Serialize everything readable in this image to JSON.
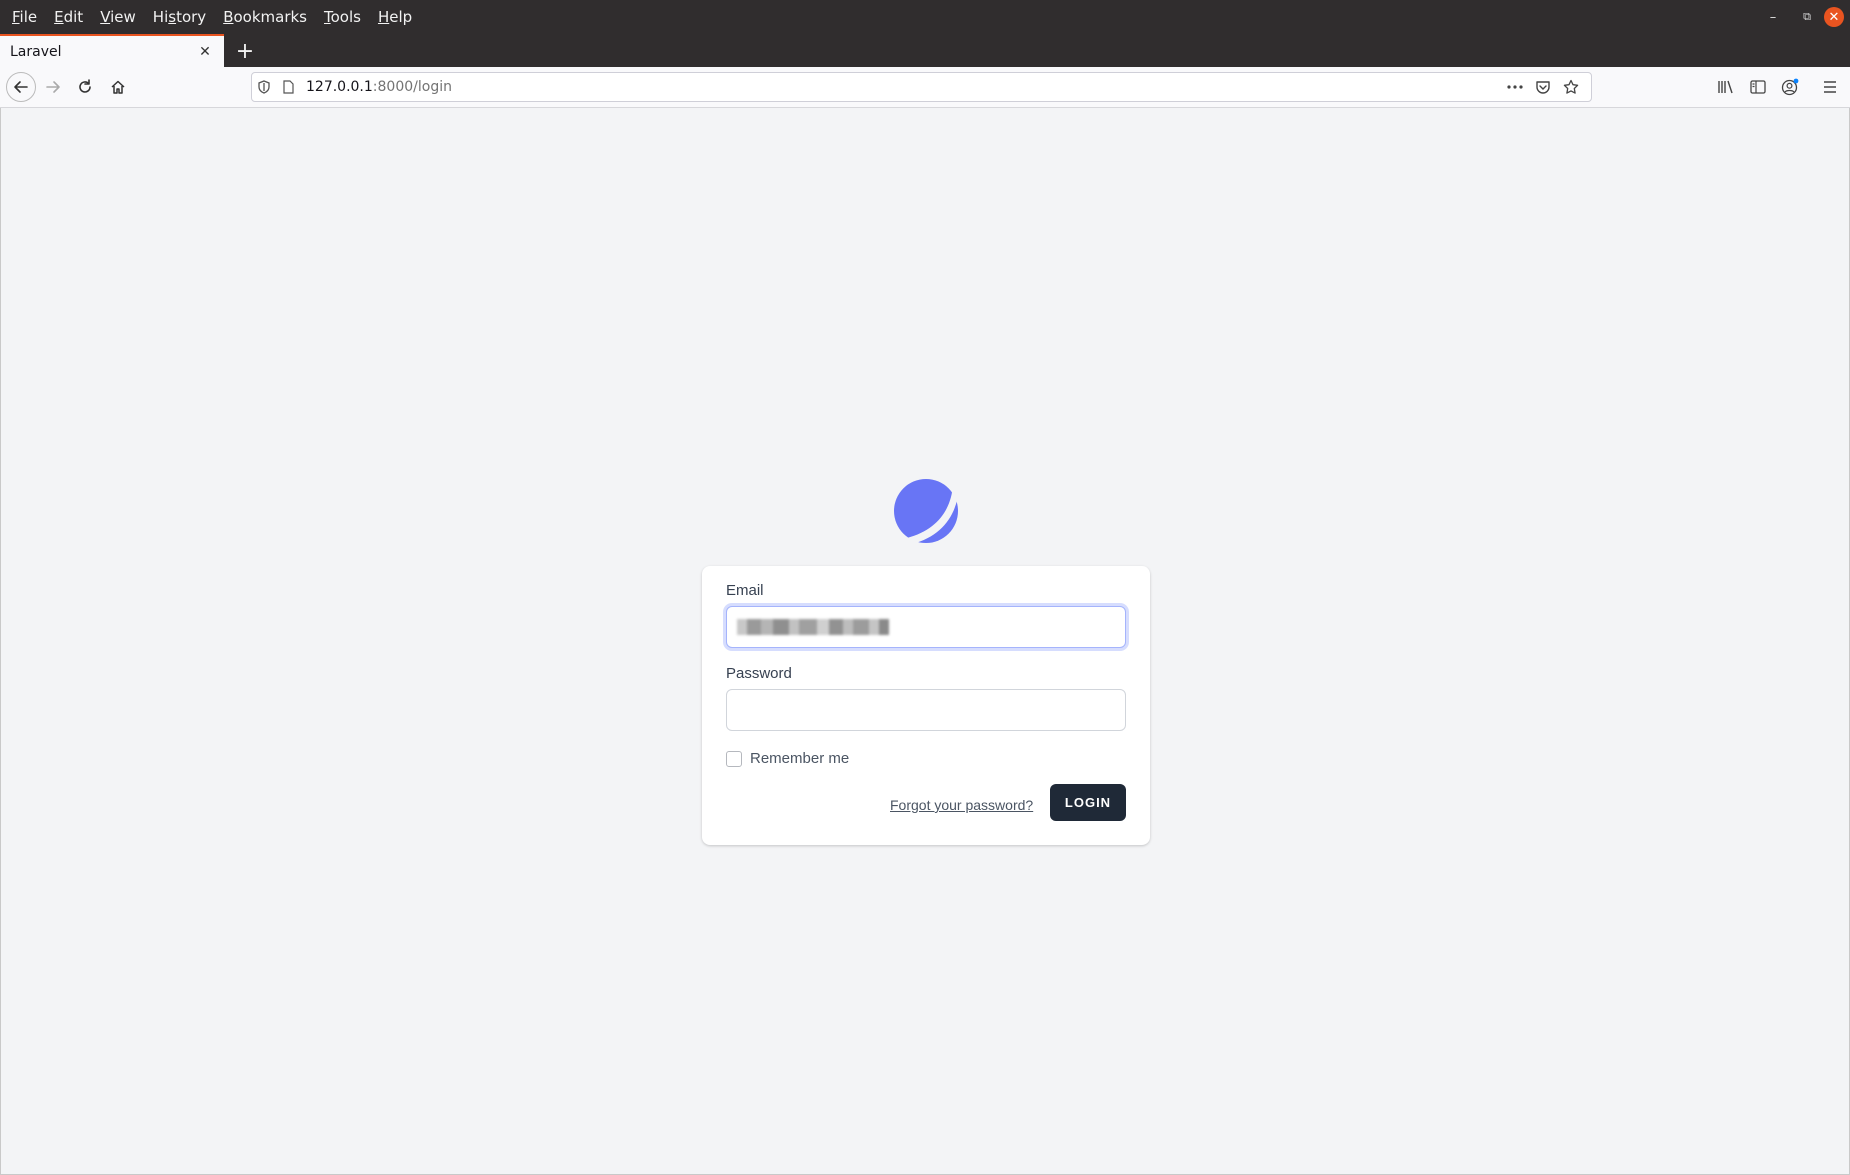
{
  "menubar": {
    "items": [
      {
        "pre": "",
        "ul": "F",
        "post": "ile"
      },
      {
        "pre": "",
        "ul": "E",
        "post": "dit"
      },
      {
        "pre": "",
        "ul": "V",
        "post": "iew"
      },
      {
        "pre": "Hi",
        "ul": "s",
        "post": "tory"
      },
      {
        "pre": "",
        "ul": "B",
        "post": "ookmarks"
      },
      {
        "pre": "",
        "ul": "T",
        "post": "ools"
      },
      {
        "pre": "",
        "ul": "H",
        "post": "elp"
      }
    ]
  },
  "window": {
    "minimize_glyph": "–",
    "restore_glyph": "⧉",
    "close_glyph": "✕"
  },
  "tab": {
    "title": "Laravel",
    "close_glyph": "✕",
    "new_tab_glyph": "+"
  },
  "urlbar": {
    "host": "127.0.0.1",
    "path": ":8000/login"
  },
  "login": {
    "email_label": "Email",
    "email_value": "[redacted]",
    "password_label": "Password",
    "password_value": "",
    "remember_label": "Remember me",
    "remember_checked": false,
    "forgot_label": "Forgot your password?",
    "login_label": "LOGIN"
  },
  "colors": {
    "accent": "#6875f5",
    "button": "#1f2937",
    "firefox_tab_accent": "#e95420",
    "page_bg": "#f3f4f6"
  }
}
